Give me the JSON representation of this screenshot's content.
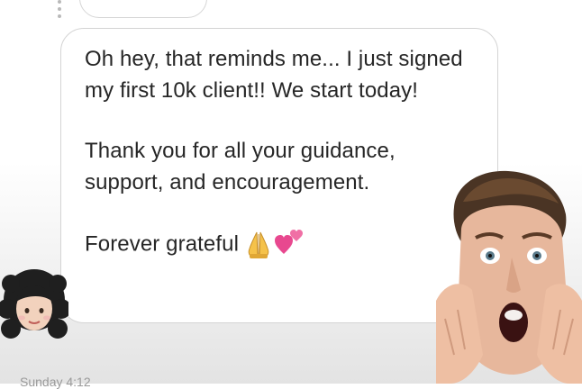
{
  "message": {
    "line1": "Oh hey, that reminds me... I just signed my first 10k client!! We start today!",
    "line2": "Thank you for all your guidance, support, and encouragement.",
    "line3": "Forever grateful"
  },
  "icons": {
    "pray": "folded-hands-icon",
    "hearts": "two-hearts-icon",
    "avatar": "woman-curly-hair-avatar",
    "reaction": "shocked-face-reaction-icon",
    "more": "more-vertical-icon"
  },
  "colors": {
    "text": "#262626",
    "bubble_border": "#d4d4d4",
    "heart_pink": "#e8488f",
    "skin": "#f2d2bd",
    "hair": "#1f1f1f"
  },
  "footer": {
    "partial_text": "Sunday 4:12"
  }
}
